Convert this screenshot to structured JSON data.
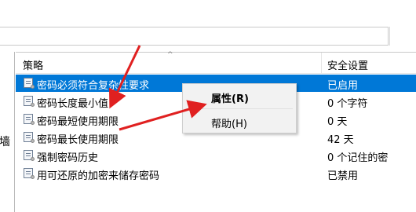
{
  "header": {
    "col_policy": "策略",
    "col_setting": "安全设置"
  },
  "left_pane_text": "墙",
  "rows": [
    {
      "name": "密码必须符合复杂性要求",
      "value": "已启用"
    },
    {
      "name": "密码长度最小值",
      "value": "0 个字符"
    },
    {
      "name": "密码最短使用期限",
      "value": "0 天"
    },
    {
      "name": "密码最长使用期限",
      "value": "42 天"
    },
    {
      "name": "强制密码历史",
      "value": "0 个记住的密"
    },
    {
      "name": "用可还原的加密来储存密码",
      "value": "已禁用"
    }
  ],
  "context_menu": {
    "properties": "属性(R)",
    "help": "帮助(H)"
  },
  "colors": {
    "selection": "#0078d7",
    "arrow": "#e02020"
  }
}
